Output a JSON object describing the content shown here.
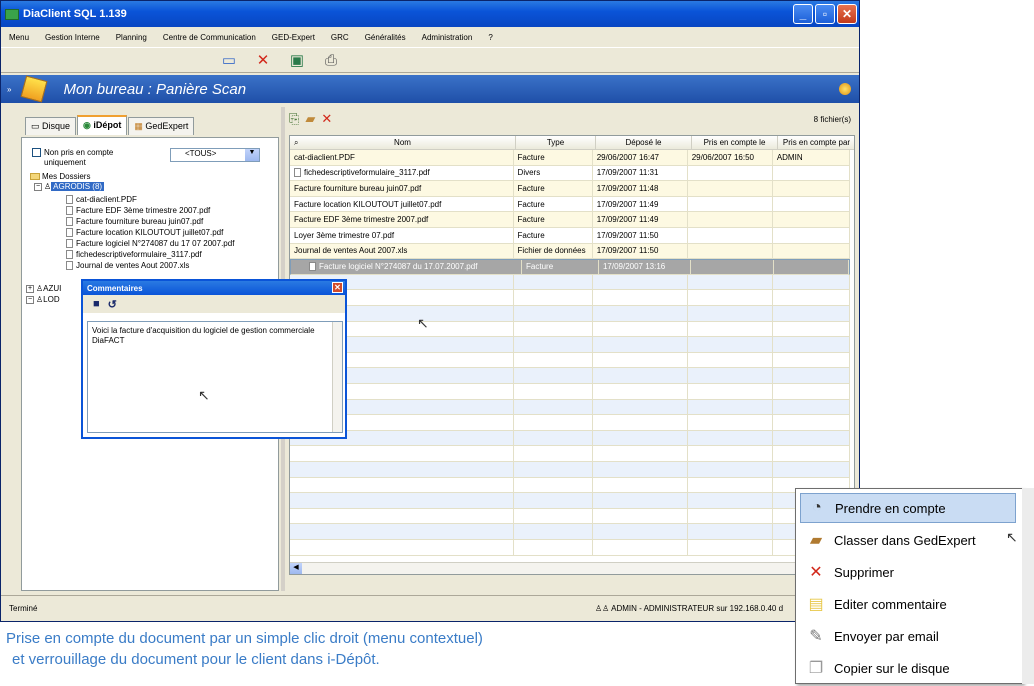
{
  "window": {
    "title": "DiaClient SQL 1.139"
  },
  "menu": [
    "Menu",
    "Gestion Interne",
    "Planning",
    "Centre de Communication",
    "GED-Expert",
    "GRC",
    "Généralités",
    "Administration",
    "?"
  ],
  "bureau": {
    "title": "Mon bureau : Panière Scan"
  },
  "tabs": [
    "Disque",
    "iDépot",
    "GedExpert"
  ],
  "left": {
    "checkbox_label": "Non pris en compte uniquement",
    "select_value": "<TOUS>",
    "root": "Mes Dossiers",
    "company": "AGRODIS (8)",
    "files": [
      "cat-diaclient.PDF",
      "Facture EDF 3ème trimestre 2007.pdf",
      "Facture fourniture bureau juin07.pdf",
      "Facture location KILOUTOUT juillet07.pdf",
      "Facture logiciel N°274087 du 17 07 2007.pdf",
      "fichedescriptiveformulaire_3117.pdf",
      "Journal de ventes Aout 2007.xls"
    ],
    "other_nodes": [
      "AZUI",
      "LOD"
    ]
  },
  "grid": {
    "file_count": "8 fichier(s)",
    "headers": [
      "Nom",
      "Type",
      "Déposé le",
      "Pris en compte le",
      "Pris en compte par"
    ],
    "rows": [
      [
        "cat-diaclient.PDF",
        "Facture",
        "29/06/2007 16:47",
        "29/06/2007 16:50",
        "ADMIN"
      ],
      [
        "fichedescriptiveformulaire_3117.pdf",
        "Divers",
        "17/09/2007 11:31",
        "",
        ""
      ],
      [
        "Facture fourniture bureau juin07.pdf",
        "Facture",
        "17/09/2007 11:48",
        "",
        ""
      ],
      [
        "Facture location KILOUTOUT juillet07.pdf",
        "Facture",
        "17/09/2007 11:49",
        "",
        ""
      ],
      [
        "Facture EDF 3ème trimestre 2007.pdf",
        "Facture",
        "17/09/2007 11:49",
        "",
        ""
      ],
      [
        "Loyer 3ème trimestre 07.pdf",
        "Facture",
        "17/09/2007 11:50",
        "",
        ""
      ],
      [
        "Journal de ventes Aout 2007.xls",
        "Fichier de données",
        "17/09/2007 11:50",
        "",
        ""
      ],
      [
        "Facture logiciel N°274087 du 17.07.2007.pdf",
        "Facture",
        "17/09/2007 13:16",
        "",
        ""
      ]
    ]
  },
  "dialog": {
    "title": "Commentaires",
    "text": "Voici la facture d'acquisition du logiciel de gestion commerciale DiaFACT"
  },
  "status": {
    "left": "Terminé",
    "user": "ADMIN - ADMINISTRATEUR sur 192.168.0.40 d"
  },
  "context_menu": [
    {
      "label": "Prendre en compte",
      "icon": "lock-clock-icon"
    },
    {
      "label": "Classer dans GedExpert",
      "icon": "folder-file-icon"
    },
    {
      "label": "Supprimer",
      "icon": "red-cross-icon"
    },
    {
      "label": "Editer commentaire",
      "icon": "note-icon"
    },
    {
      "label": "Envoyer par email",
      "icon": "pen-icon"
    },
    {
      "label": "Copier sur le disque",
      "icon": "copy-icon"
    }
  ],
  "caption": {
    "line1": "Prise en compte du document par un simple clic droit (menu contextuel)",
    "line2": "et verrouillage du document pour le client dans i-Dépôt."
  }
}
